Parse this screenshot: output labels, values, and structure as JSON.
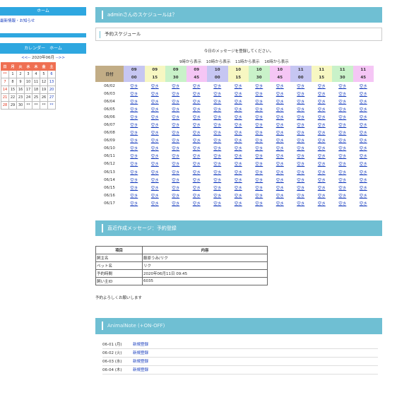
{
  "sidebar": {
    "home_label": "ホーム",
    "news_link": "最新情報・お知らせ",
    "calendar_title": "カレンダー　ホーム",
    "calendar_nav": {
      "prev": "<<--",
      "month": "2020年06月",
      "next": "-->>"
    },
    "calendar_headers": [
      "日",
      "月",
      "火",
      "水",
      "木",
      "金",
      "土"
    ],
    "calendar_weeks": [
      [
        "**",
        "1",
        "2",
        "3",
        "4",
        "5",
        "6"
      ],
      [
        "7",
        "8",
        "9",
        "10",
        "11",
        "12",
        "13"
      ],
      [
        "14",
        "15",
        "16",
        "17",
        "18",
        "19",
        "20"
      ],
      [
        "21",
        "22",
        "23",
        "24",
        "25",
        "26",
        "27"
      ],
      [
        "28",
        "29",
        "30",
        "**",
        "**",
        "**",
        "**"
      ]
    ]
  },
  "main": {
    "title": "adminさんのスケジュールは？",
    "subtitle": "予約スケジュール",
    "note": "今日のメッセージを登録してください。",
    "view_links": [
      "9時から表示",
      "10時から表示",
      "11時から表示",
      "16時から表示"
    ],
    "date_header": "日付",
    "time_slots": [
      {
        "h": "09",
        "m": "00",
        "color": "#c6c6f2"
      },
      {
        "h": "09",
        "m": "15",
        "color": "#f7f7c2"
      },
      {
        "h": "09",
        "m": "30",
        "color": "#c9f2c9"
      },
      {
        "h": "09",
        "m": "45",
        "color": "#f5c6f5"
      },
      {
        "h": "10",
        "m": "00",
        "color": "#c6c6f2"
      },
      {
        "h": "10",
        "m": "15",
        "color": "#f7f7c2"
      },
      {
        "h": "10",
        "m": "30",
        "color": "#c9f2c9"
      },
      {
        "h": "10",
        "m": "45",
        "color": "#f5c6f5"
      },
      {
        "h": "11",
        "m": "00",
        "color": "#c6c6f2"
      },
      {
        "h": "11",
        "m": "15",
        "color": "#f7f7c2"
      },
      {
        "h": "11",
        "m": "30",
        "color": "#c9f2c9"
      },
      {
        "h": "11",
        "m": "45",
        "color": "#f5c6f5"
      }
    ],
    "cell_label": "空き",
    "dates": [
      "06/02",
      "06/03",
      "06/04",
      "06/05",
      "06/06",
      "06/07",
      "06/08",
      "06/09",
      "06/10",
      "06/11",
      "06/12",
      "06/13",
      "06/14",
      "06/15",
      "06/16",
      "06/17"
    ]
  },
  "message_section": {
    "title": "直近作成メッセージ：予約登録",
    "headers": [
      "項目",
      "内容"
    ],
    "rows": [
      [
        "飼主名",
        "藤原うみ/リク"
      ],
      [
        "ペット名",
        "リク"
      ],
      [
        "予約時間",
        "2020年06月11日 09:45"
      ],
      [
        "飼い主ID",
        "6035"
      ]
    ],
    "footer": "予約よろしくお願いします"
  },
  "animal_note": {
    "title": "AnimalNote (+ON-OFF)",
    "entries": [
      {
        "date": "06-01 (月)",
        "link": "新規登録"
      },
      {
        "date": "06-02 (火)",
        "link": "新規登録"
      },
      {
        "date": "06-03 (水)",
        "link": "新規登録"
      },
      {
        "date": "06-04 (木)",
        "link": "新規登録"
      }
    ]
  }
}
